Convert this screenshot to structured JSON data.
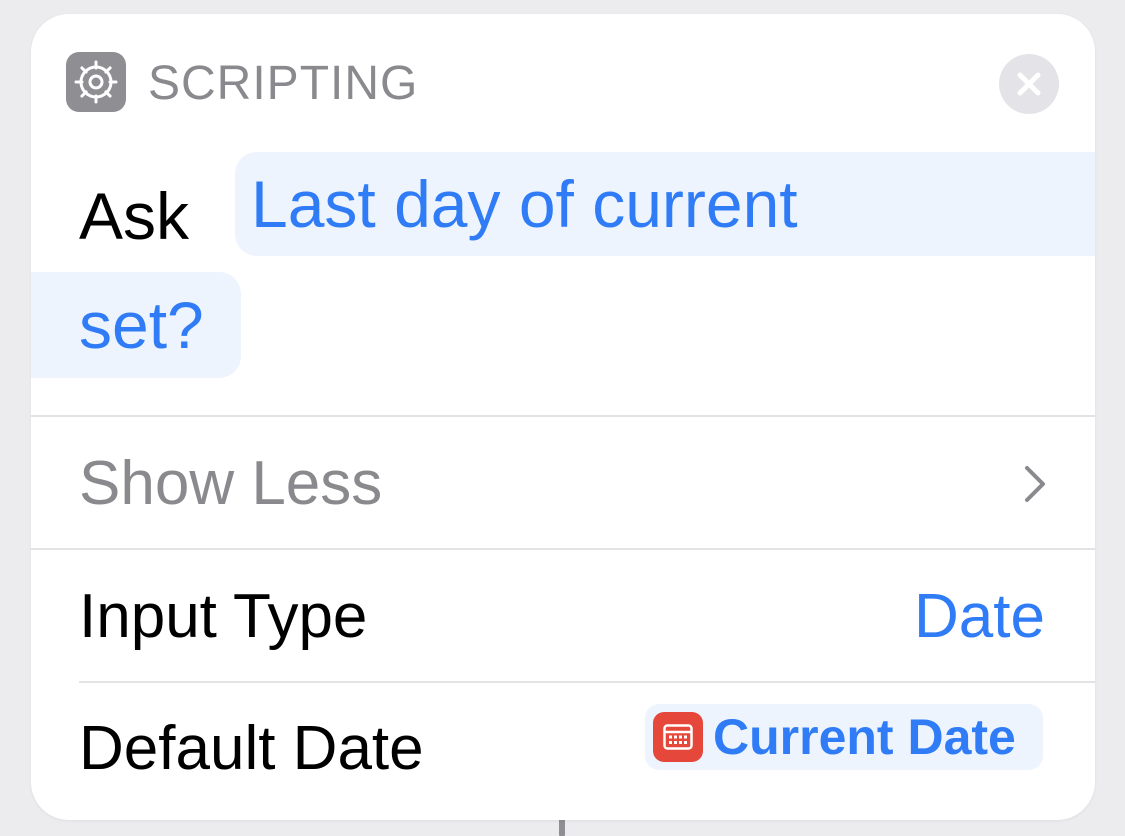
{
  "header": {
    "category": "SCRIPTING",
    "app_icon": "gear-icon",
    "close_icon": "close-icon"
  },
  "action": {
    "verb": "Ask",
    "prompt_line1": "Last day of current",
    "prompt_line2": "set?"
  },
  "show_less": {
    "label": "Show Less",
    "icon": "chevron-right-icon"
  },
  "input_type": {
    "label": "Input Type",
    "value": "Date"
  },
  "default_date": {
    "label": "Default Date",
    "value": "Current Date",
    "icon": "calendar-icon"
  },
  "colors": {
    "accent": "#2f7cf6",
    "chip_background": "#edf4fe",
    "calendar_red": "#e5473b",
    "muted_text": "#8a8a8e"
  }
}
